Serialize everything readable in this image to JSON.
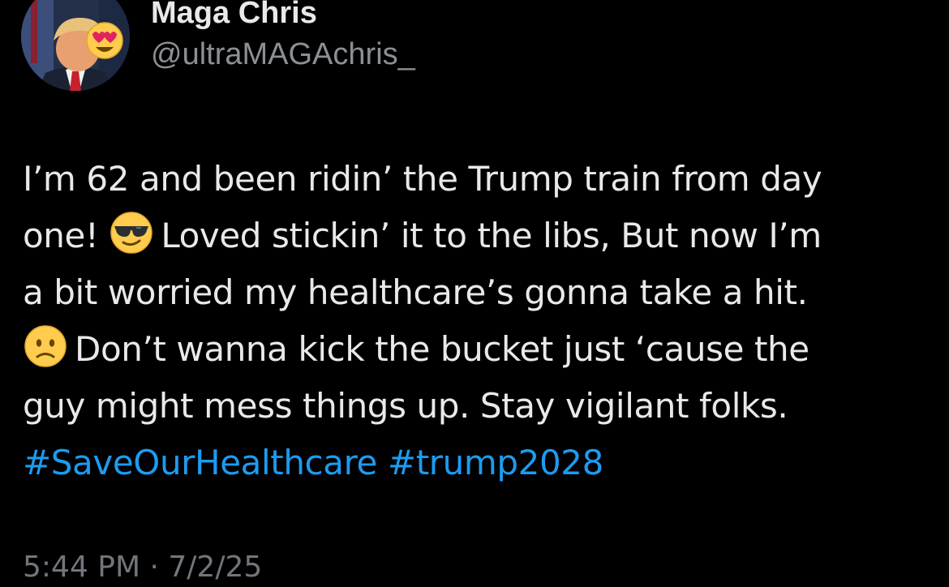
{
  "author": {
    "display_name": "Maga Chris",
    "handle": "@ultraMAGAchris_",
    "avatar_icon": "profile-photo-with-heart-eyes-emoji"
  },
  "tweet": {
    "lines": [
      {
        "text": "I’m 62 and been ridin’ the Trump train from day"
      },
      {
        "prefix": "one!",
        "emoji": "sunglasses-face-emoji",
        "text": "Loved stickin’ it to the libs, But now I’m"
      },
      {
        "text": "a bit worried my healthcare’s gonna take a hit."
      },
      {
        "emoji": "slightly-frowning-face-emoji",
        "text": "Don’t wanna kick the bucket just ‘cause the"
      },
      {
        "text": "guy might mess things up. Stay vigilant folks."
      }
    ],
    "hashtags": [
      "#SaveOurHealthcare",
      "#trump2028"
    ],
    "timestamp": "5:44 PM · 7/2/25"
  },
  "colors": {
    "background": "#000000",
    "text": "#e7e9ea",
    "secondary_text": "#8b9096",
    "hashtag": "#1d9bf0"
  }
}
